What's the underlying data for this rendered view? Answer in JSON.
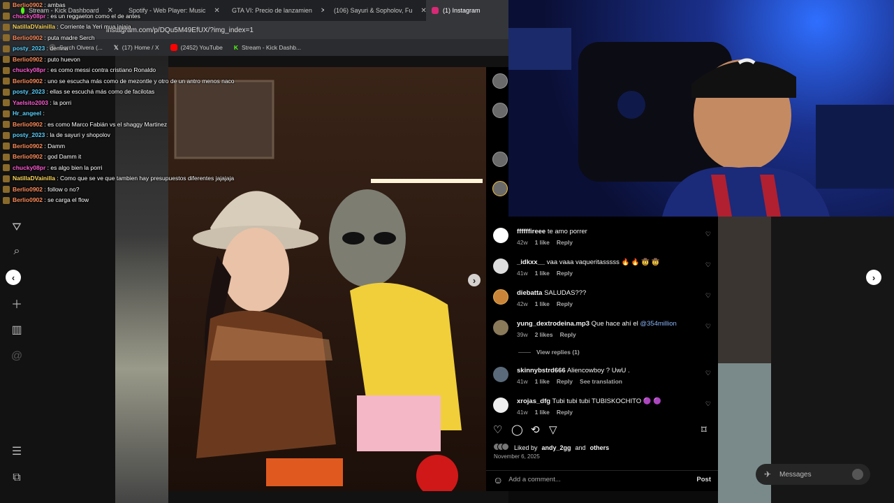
{
  "browser": {
    "tabs": [
      {
        "label": "Stream - Kick Dashboard"
      },
      {
        "label": "Spotify - Web Player: Music"
      },
      {
        "label": "GTA VI: Precio de lanzamien"
      },
      {
        "label": "(106) Sayuri & Sopholov, Fu"
      },
      {
        "label": "(1) Instagram"
      }
    ],
    "url": "instagram.com/p/DQu5M49EfUX/?img_index=1",
    "bookmarks": [
      "Serch Olvera (...",
      "(17) Home / X",
      "(2452) YouTube",
      "Stream - Kick Dashb..."
    ]
  },
  "chat": [
    {
      "user": "Berlio0902",
      "msg": "ambas",
      "color": "#ff8c5a"
    },
    {
      "user": "chucky08pr",
      "msg": "es un reggaeton como el de antes",
      "color": "#ff5ad2"
    },
    {
      "user": "NatillaDVainilla",
      "msg": "Corriente la Yeri mua jajaja",
      "color": "#ffd95a"
    },
    {
      "user": "Berlio0902",
      "msg": "puta madre Serch",
      "color": "#ff8c5a"
    },
    {
      "user": "posty_2023",
      "msg": "demna",
      "color": "#5ad2ff"
    },
    {
      "user": "Berlio0902",
      "msg": "puto huevon",
      "color": "#ff8c5a"
    },
    {
      "user": "chucky08pr",
      "msg": "es como messi contra cristiano Ronaldo",
      "color": "#ff5ad2"
    },
    {
      "user": "Berlio0902",
      "msg": "uno se escucha más como de mezontle y otro de un antro menos naco",
      "color": "#ff8c5a"
    },
    {
      "user": "posty_2023",
      "msg": "ellas se escuchá más como de facilotas",
      "color": "#5ad2ff"
    },
    {
      "user": "Yaelsito2003",
      "msg": "la porri",
      "color": "#ff5ad2"
    },
    {
      "user": "Hr_angeel",
      "msg": "",
      "color": "#5ad2ff"
    },
    {
      "user": "Berlio0902",
      "msg": "es como Marco Fabián vs el shaggy Martinez",
      "color": "#ff8c5a"
    },
    {
      "user": "posty_2023",
      "msg": "la de sayuri y shopolov",
      "color": "#5ad2ff"
    },
    {
      "user": "Berlio0902",
      "msg": "Damm",
      "color": "#ff8c5a"
    },
    {
      "user": "Berlio0902",
      "msg": "god Damm it",
      "color": "#ff8c5a"
    },
    {
      "user": "chucky08pr",
      "msg": "es algo bien la porri",
      "color": "#ff5ad2"
    },
    {
      "user": "NatillaDVainilla",
      "msg": "Como que se ve que tambien hay presupuestos diferentes jajajaja",
      "color": "#ffd95a"
    },
    {
      "user": "Berlio0902",
      "msg": "follow o no?",
      "color": "#ff8c5a"
    },
    {
      "user": "Berlio0902",
      "msg": "se carga el flow",
      "color": "#ff8c5a"
    }
  ],
  "comments": [
    {
      "user": "ffffffireee",
      "text": "te amo porrer",
      "age": "42w",
      "likes": "1 like",
      "reply": "Reply"
    },
    {
      "user": "_idkxx__",
      "text": "vaa vaaa vaqueritasssss 🔥 🔥 🤠 🤠",
      "age": "41w",
      "likes": "1 like",
      "reply": "Reply"
    },
    {
      "user": "diebatta",
      "text": "SALUDAS???",
      "age": "42w",
      "likes": "1 like",
      "reply": "Reply"
    },
    {
      "user": "yung_dextrodeina.mp3",
      "text": "Que hace ahí el",
      "mention": "@354million",
      "age": "39w",
      "likes": "2 likes",
      "reply": "Reply"
    },
    {
      "user": "skinnybstrd666",
      "text": "Aliencowboy ? UwU .",
      "age": "41w",
      "likes": "1 like",
      "reply": "Reply",
      "extra": "See translation"
    },
    {
      "user": "xrojas_dfg",
      "text": "Tubi tubi tubi TUBISKOCHITO 🟣 🟣",
      "age": "41w",
      "likes": "1 like",
      "reply": "Reply"
    }
  ],
  "view_replies": "View replies (1)",
  "liked_by": {
    "prefix": "Liked by",
    "user": "andy_2gg",
    "and": "and",
    "others": "others"
  },
  "post_date": "November 6, 2025",
  "add_comment": {
    "placeholder": "Add a comment...",
    "post": "Post"
  },
  "messages_label": "Messages"
}
